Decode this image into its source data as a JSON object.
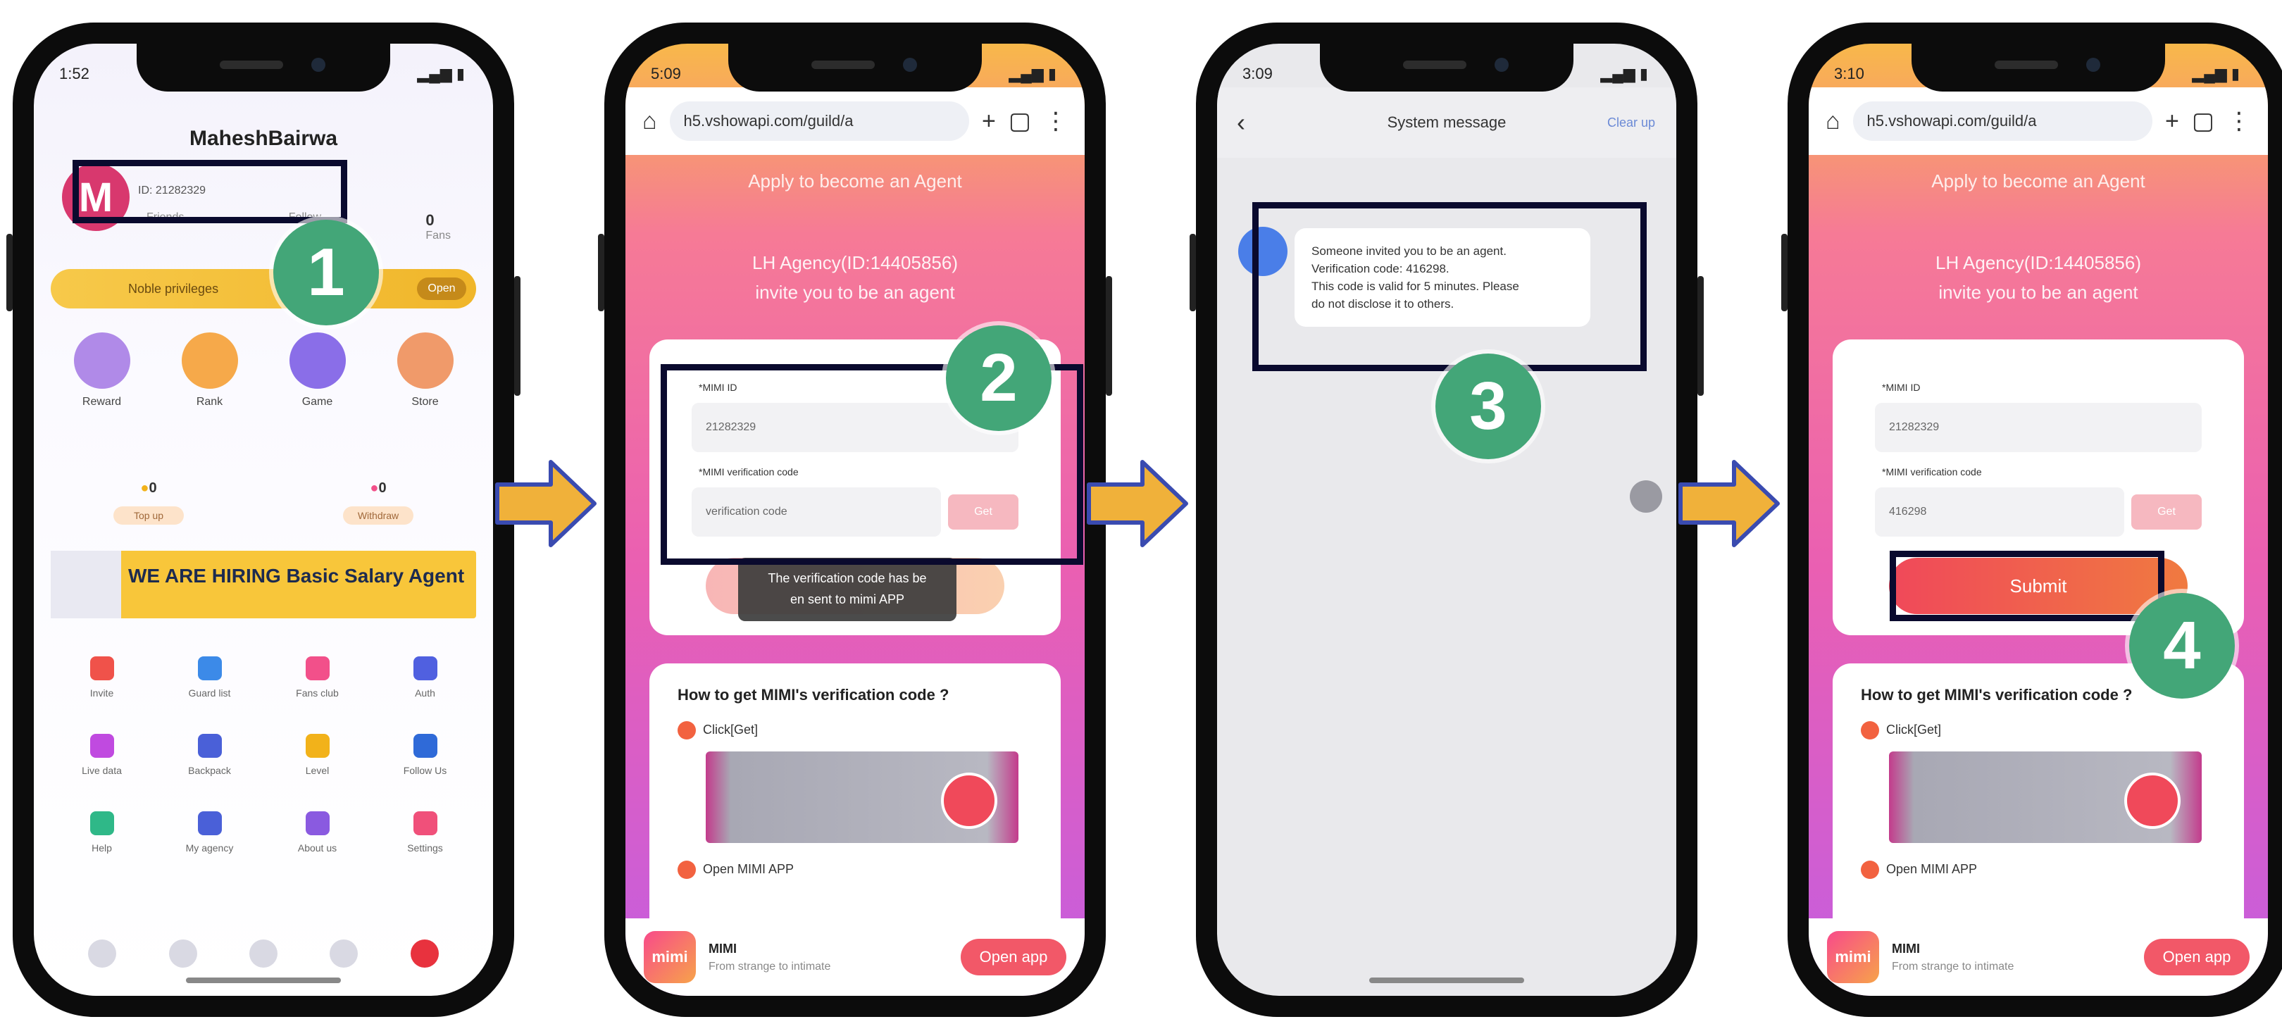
{
  "phone1": {
    "status_time": "1:52",
    "username": "MaheshBairwa",
    "avatar_letter": "M",
    "user_id": "ID: 21282329",
    "stats": [
      {
        "num": "",
        "label": "Friends"
      },
      {
        "num": "",
        "label": "Follow"
      },
      {
        "num": "0",
        "label": "Fans"
      }
    ],
    "vip_text": "Noble privileges",
    "vip_open": "Open",
    "tiles": [
      "Reward",
      "Rank",
      "Game",
      "Store"
    ],
    "coins": [
      {
        "value": "0",
        "btn": "Top up"
      },
      {
        "value": "0",
        "btn": "Withdraw"
      }
    ],
    "hiring_banner": "WE ARE HIRING Basic Salary Agent",
    "menu_row1": [
      "Invite",
      "Guard list",
      "Fans club",
      "Auth"
    ],
    "menu_row2": [
      "Live data",
      "Backpack",
      "Level",
      "Follow Us"
    ],
    "menu_row3": [
      "Help",
      "My agency",
      "About us",
      "Settings"
    ]
  },
  "phone2": {
    "status_time": "5:09",
    "url": "h5.vshowapi.com/guild/a",
    "page_title": "Apply to become an Agent",
    "agency_line1": "LH Agency(ID:14405856)",
    "agency_line2": "invite you to be an agent",
    "mimi_id_label": "*MIMI ID",
    "mimi_id_value": "21282329",
    "code_label": "*MIMI verification code",
    "code_placeholder": "verification code",
    "get_label": "Get",
    "toast_line1": "The verification code has be",
    "toast_line2": "en sent to mimi APP",
    "how_title": "How to get MIMI's verification code ?",
    "step1": "Click[Get]",
    "step2": "Open MIMI APP",
    "app_name": "MIMI",
    "app_slogan": "From strange to intimate",
    "open_app": "Open app",
    "app_logo": "mimi"
  },
  "phone3": {
    "status_time": "3:09",
    "title": "System message",
    "clear_up": "Clear up",
    "msg_time": "",
    "msg_line1": "Someone invited you to be an agent.",
    "msg_line2": "Verification code: 416298.",
    "msg_line3": "This code is valid for 5 minutes. Please",
    "msg_line4": "do not disclose it to others."
  },
  "phone4": {
    "status_time": "3:10",
    "url": "h5.vshowapi.com/guild/a",
    "page_title": "Apply to become an Agent",
    "agency_line1": "LH Agency(ID:14405856)",
    "agency_line2": "invite you to be an agent",
    "mimi_id_label": "*MIMI ID",
    "mimi_id_value": "21282329",
    "code_label": "*MIMI verification code",
    "code_value": "416298",
    "get_label": "Get",
    "submit": "Submit",
    "how_title": "How to get MIMI's verification code ?",
    "step1": "Click[Get]",
    "step2": "Open MIMI APP",
    "app_name": "MIMI",
    "app_slogan": "From strange to intimate",
    "open_app": "Open app",
    "app_logo": "mimi"
  },
  "steps": [
    "1",
    "2",
    "3",
    "4"
  ],
  "colors": {
    "badge": "#43a678",
    "arrow": "#f0b13a",
    "arrow_outline": "#3a4bb0",
    "highlight": "#0a0a2e"
  }
}
